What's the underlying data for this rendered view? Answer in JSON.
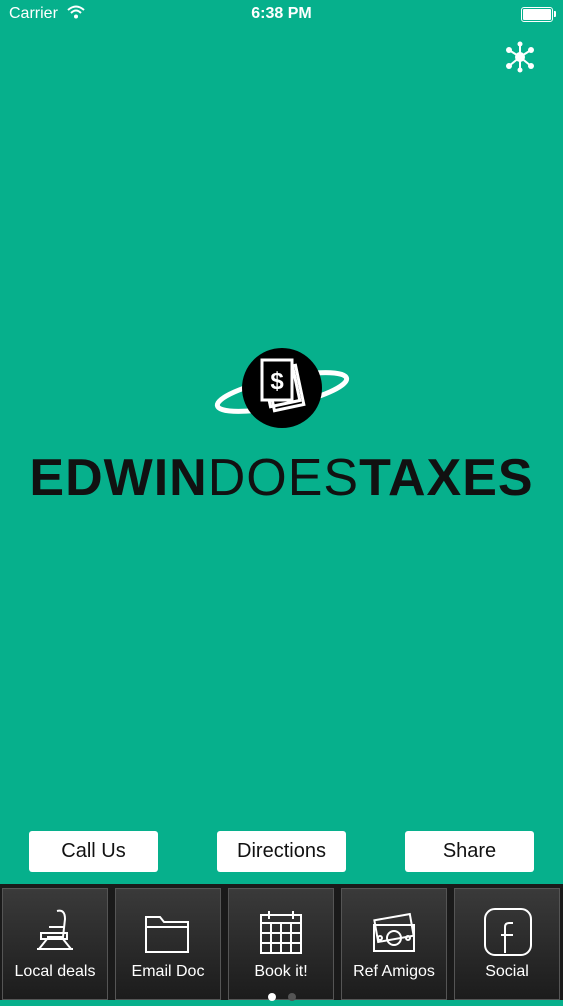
{
  "status_bar": {
    "carrier": "Carrier",
    "time": "6:38 PM"
  },
  "logo": {
    "word_bold_1": "EDWIN",
    "word_light": "DOES",
    "word_bold_2": "TAXES",
    "mark_symbol": "$"
  },
  "actions": [
    {
      "label": "Call Us"
    },
    {
      "label": "Directions"
    },
    {
      "label": "Share"
    }
  ],
  "tabs": [
    {
      "label": "Local deals",
      "icon": "barber-chair-icon"
    },
    {
      "label": "Email Doc",
      "icon": "folder-icon"
    },
    {
      "label": "Book it!",
      "icon": "calendar-icon"
    },
    {
      "label": "Ref Amigos",
      "icon": "money-icon"
    },
    {
      "label": "Social",
      "icon": "facebook-icon"
    }
  ],
  "pager": {
    "page_count": 2,
    "active_page": 1
  },
  "colors": {
    "background": "#06b08c",
    "tabbar": "#1a1a1a"
  }
}
